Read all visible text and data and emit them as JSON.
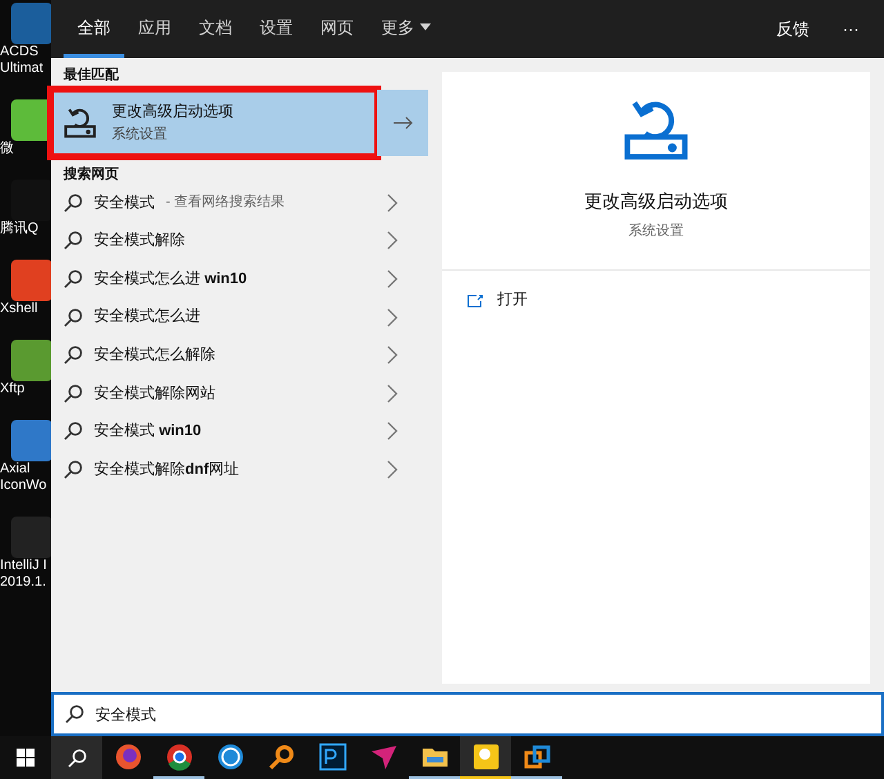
{
  "desktop_icons": [
    {
      "label": "ACDS\nUltimat",
      "color": "#1b5e9c"
    },
    {
      "label": "微",
      "color": "#5dbb3a"
    },
    {
      "label": "腾讯Q",
      "color": "#111111"
    },
    {
      "label": "Xshell",
      "color": "#e04020"
    },
    {
      "label": "Xftp",
      "color": "#5a9a30"
    },
    {
      "label": "Axial\nIconWo",
      "color": "#2f78c8"
    },
    {
      "label": "IntelliJ I\n2019.1.",
      "color": "#222222"
    }
  ],
  "tabs": [
    {
      "label": "全部",
      "selected": true
    },
    {
      "label": "应用",
      "selected": false
    },
    {
      "label": "文档",
      "selected": false
    },
    {
      "label": "设置",
      "selected": false
    },
    {
      "label": "网页",
      "selected": false
    },
    {
      "label": "更多",
      "selected": false
    }
  ],
  "feedback": "反馈",
  "more_options": "···",
  "best_match": {
    "heading": "最佳匹配",
    "title": "更改高级启动选项",
    "subtitle": "系统设置",
    "selected": true
  },
  "web_search": {
    "heading": "搜索网页",
    "items": [
      {
        "text": "安全模式",
        "hint": "- 查看网络搜索结果"
      },
      {
        "text": "安全模式解除"
      },
      {
        "text": "安全模式怎么进 **win10**"
      },
      {
        "text": "安全模式怎么进"
      },
      {
        "text": "安全模式怎么解除"
      },
      {
        "text": "安全模式解除网站"
      },
      {
        "text": "安全模式 **win10**"
      },
      {
        "text": "安全模式解除**dnf**网址"
      }
    ]
  },
  "preview": {
    "title": "更改高级启动选项",
    "subtitle": "系统设置",
    "actions": [
      "打开"
    ]
  },
  "search_box": {
    "value": "安全模式"
  },
  "taskbar": [
    {
      "kind": "firefox",
      "active": false
    },
    {
      "kind": "chrome",
      "active": true
    },
    {
      "kind": "k",
      "active": false
    },
    {
      "kind": "magnifier",
      "active": false
    },
    {
      "kind": "ps",
      "active": false
    },
    {
      "kind": "plane",
      "active": false
    },
    {
      "kind": "folder",
      "active": true
    },
    {
      "kind": "yellow",
      "active": true
    },
    {
      "kind": "squares",
      "active": true
    }
  ]
}
